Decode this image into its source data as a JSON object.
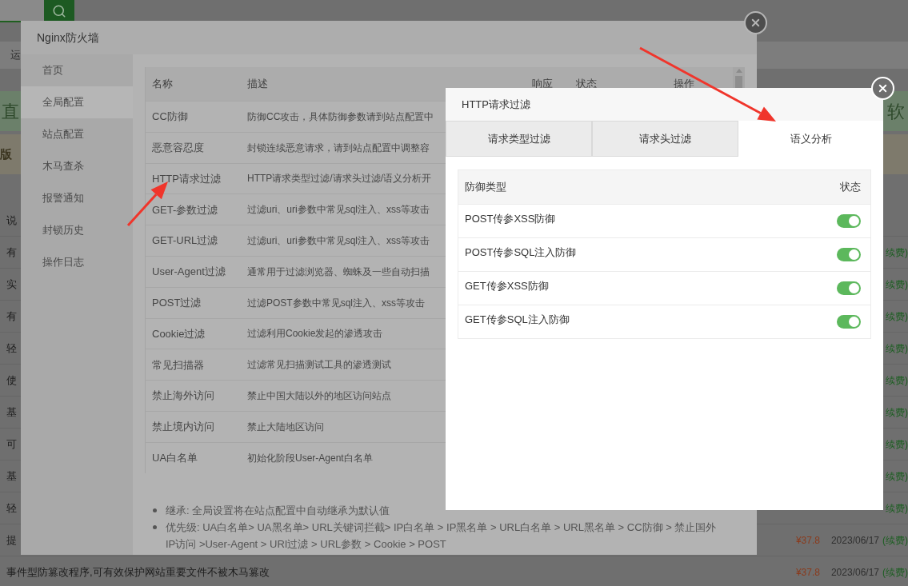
{
  "background": {
    "nav_snippet": "运",
    "banner_left": "直",
    "banner_right": "软",
    "sub_banner": "版",
    "rows": [
      {
        "label": "说"
      },
      {
        "label": "有",
        "renew": "续费)"
      },
      {
        "label": "实",
        "renew": "续费)"
      },
      {
        "label": "有",
        "renew": "续费)"
      },
      {
        "label": "轻",
        "renew": "续费)"
      },
      {
        "label": "使",
        "renew": "续费)"
      },
      {
        "label": "基",
        "renew": "续费)"
      },
      {
        "label": "可",
        "renew": "续费)"
      },
      {
        "label": "基",
        "renew": "续费)"
      },
      {
        "label": "轻",
        "renew": "续费)"
      },
      {
        "label": "提",
        "price": "¥37.8",
        "date": "2023/06/17",
        "renew": "(续费)"
      },
      {
        "label": "事件型防篡改程序,可有效保护网站重要文件不被木马篡改",
        "price": "¥37.8",
        "date": "2023/06/17",
        "renew": "(续费)"
      }
    ]
  },
  "firewall_window": {
    "title": "Nginx防火墙",
    "sidebar": [
      {
        "label": "首页",
        "selected": false
      },
      {
        "label": "全局配置",
        "selected": true
      },
      {
        "label": "站点配置",
        "selected": false
      },
      {
        "label": "木马查杀",
        "selected": false
      },
      {
        "label": "报警通知",
        "selected": false
      },
      {
        "label": "封锁历史",
        "selected": false
      },
      {
        "label": "操作日志",
        "selected": false
      }
    ],
    "table": {
      "columns": [
        "名称",
        "描述",
        "响应",
        "状态",
        "操作"
      ],
      "rows": [
        {
          "name": "CC防御",
          "description": "防御CC攻击，具体防御参数请到站点配置中"
        },
        {
          "name": "恶意容忍度",
          "description": "封锁连续恶意请求，请到站点配置中调整容"
        },
        {
          "name": "HTTP请求过滤",
          "description": "HTTP请求类型过滤/请求头过滤/语义分析开"
        },
        {
          "name": "GET-参数过滤",
          "description": "过滤uri、uri参数中常见sql注入、xss等攻击"
        },
        {
          "name": "GET-URL过滤",
          "description": "过滤uri、uri参数中常见sql注入、xss等攻击"
        },
        {
          "name": "User-Agent过滤",
          "description": "通常用于过滤浏览器、蜘蛛及一些自动扫描"
        },
        {
          "name": "POST过滤",
          "description": "过滤POST参数中常见sql注入、xss等攻击"
        },
        {
          "name": "Cookie过滤",
          "description": "过滤利用Cookie发起的渗透攻击"
        },
        {
          "name": "常见扫描器",
          "description": "过滤常见扫描测试工具的渗透测试"
        },
        {
          "name": "禁止海外访问",
          "description": "禁止中国大陆以外的地区访问站点"
        },
        {
          "name": "禁止境内访问",
          "description": "禁止大陆地区访问"
        },
        {
          "name": "UA白名单",
          "description": "初始化阶段User-Agent白名单"
        }
      ]
    },
    "notes": [
      "继承: 全局设置将在站点配置中自动继承为默认值",
      "优先级: UA白名单> UA黑名单> URL关键词拦截> IP白名单 > IP黑名单 > URL白名单 > URL黑名单 > CC防御 > 禁止国外IP访问 >User-Agent > URI过滤 > URL参数 > Cookie > POST"
    ]
  },
  "http_filter_dialog": {
    "title": "HTTP请求过滤",
    "tabs": [
      {
        "label": "请求类型过滤",
        "selected": false
      },
      {
        "label": "请求头过滤",
        "selected": false
      },
      {
        "label": "语义分析",
        "selected": true
      }
    ],
    "table": {
      "columns": [
        "防御类型",
        "状态"
      ],
      "rows": [
        {
          "name": "POST传参XSS防御",
          "on": true
        },
        {
          "name": "POST传参SQL注入防御",
          "on": true
        },
        {
          "name": "GET传参XSS防御",
          "on": true
        },
        {
          "name": "GET传参SQL注入防御",
          "on": true
        }
      ]
    }
  }
}
